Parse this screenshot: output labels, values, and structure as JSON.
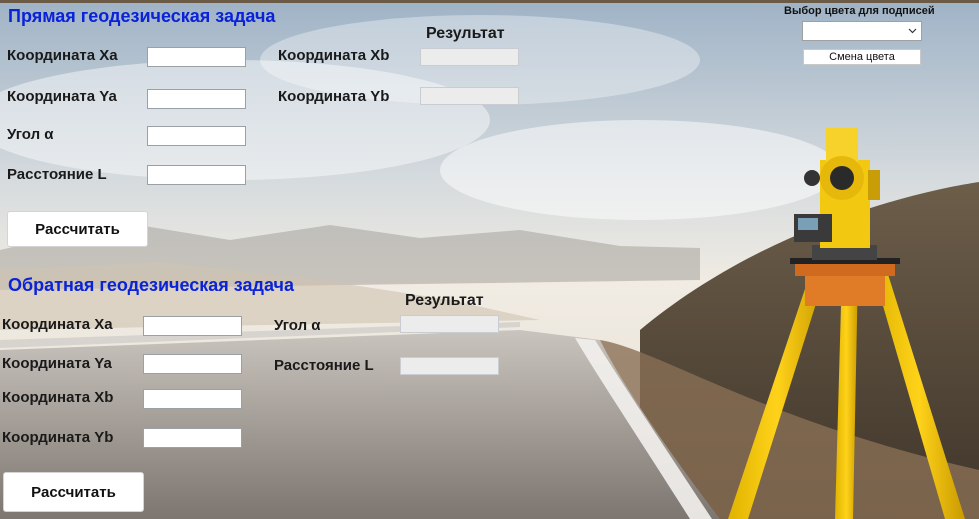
{
  "direct": {
    "title": "Прямая геодезическая задача",
    "result_title": "Результат",
    "labels": {
      "xa": "Координата Xa",
      "ya": "Координата Ya",
      "angle": "Угол α",
      "distance": "Расстояние L",
      "xb": "Координата Xb",
      "yb": "Координата Yb"
    },
    "inputs": {
      "xa": "",
      "ya": "",
      "angle": "",
      "distance": ""
    },
    "outputs": {
      "xb": "",
      "yb": ""
    },
    "calc_button": "Рассчитать"
  },
  "inverse": {
    "title": "Обратная геодезическая задача",
    "result_title": "Результат",
    "labels": {
      "xa": "Координата Xa",
      "ya": "Координата Ya",
      "xb": "Координата Xb",
      "yb": "Координата Yb",
      "angle": "Угол α",
      "distance": "Расстояние L"
    },
    "inputs": {
      "xa": "",
      "ya": "",
      "xb": "",
      "yb": ""
    },
    "outputs": {
      "angle": "",
      "distance": ""
    },
    "calc_button": "Рассчитать"
  },
  "color_picker": {
    "label": "Выбор цвета для подписей",
    "selected": "",
    "change_button": "Смена цвета",
    "dropdown_icon": "chevron-down-icon"
  },
  "colors": {
    "section_title": "#0a22d8",
    "label_text": "#1a1a1a",
    "input_bg": "#ffffff",
    "output_bg": "#ececec"
  }
}
